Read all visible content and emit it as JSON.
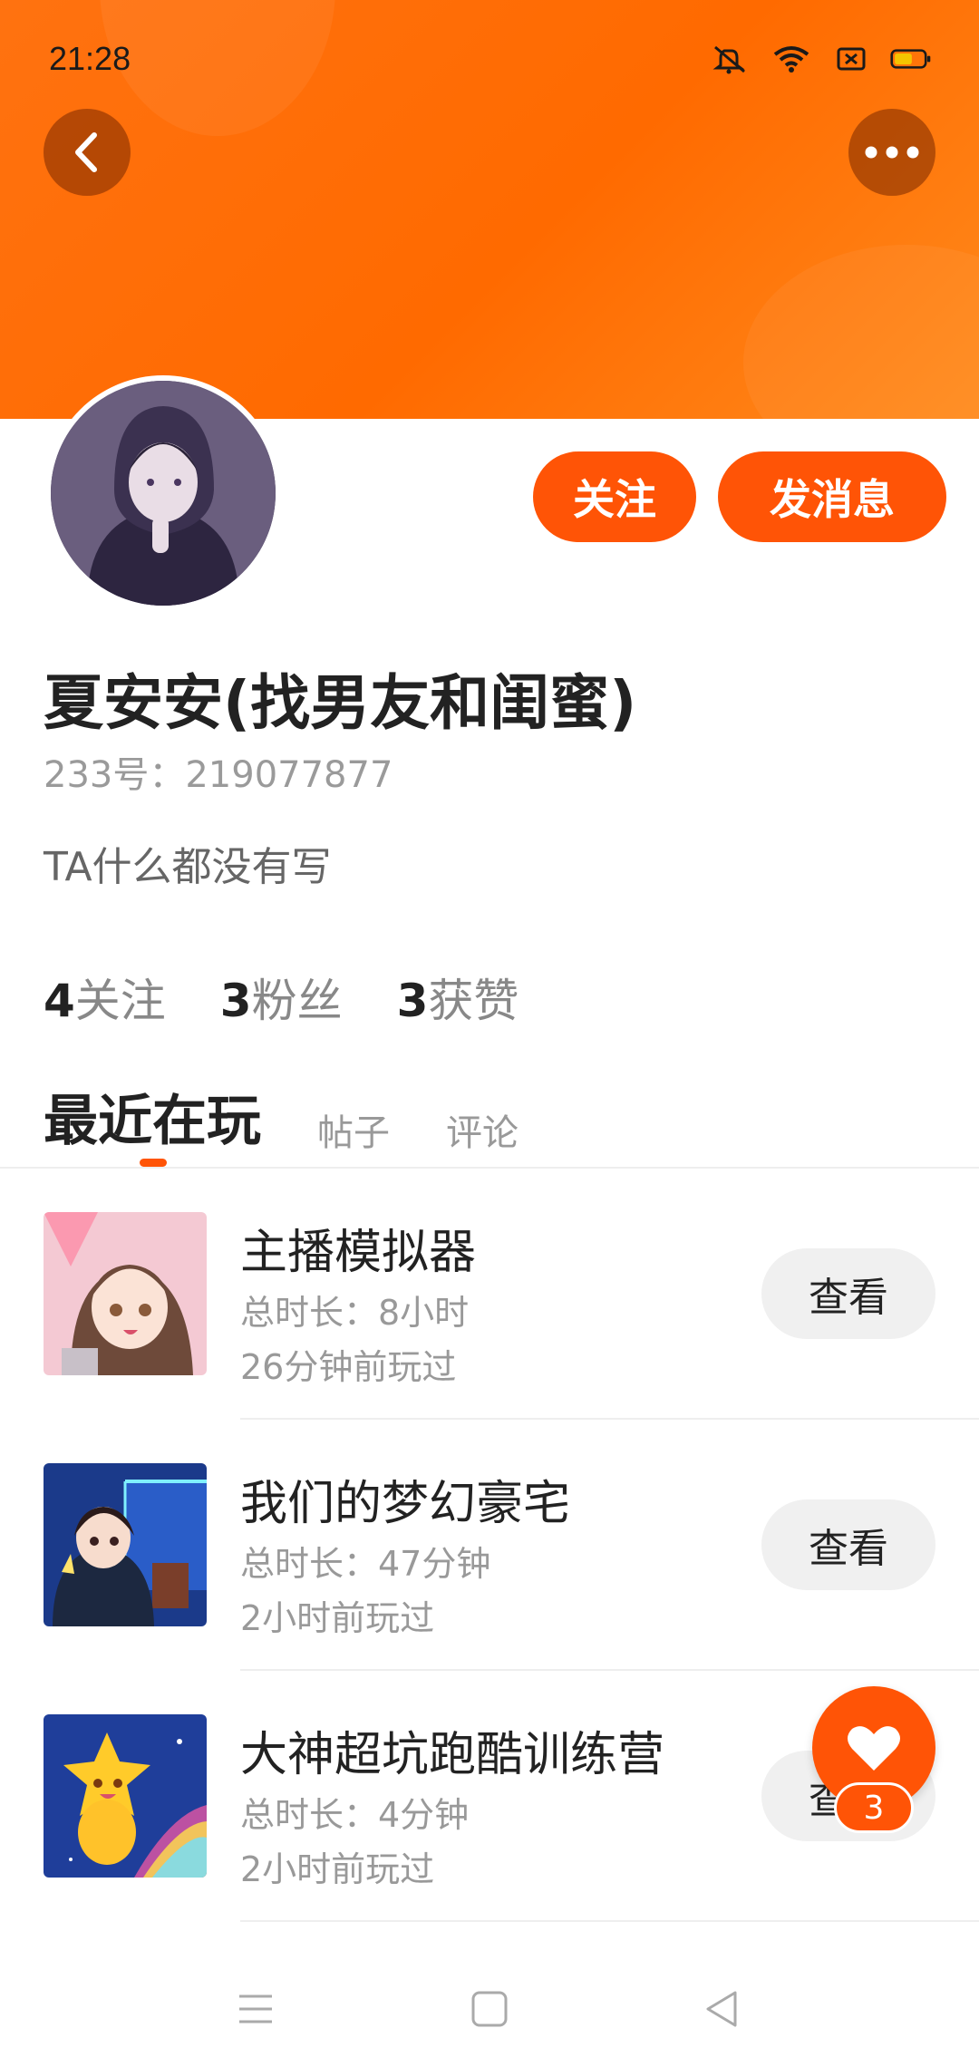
{
  "status_bar": {
    "time": "21:28"
  },
  "profile": {
    "name": "夏安安(找男友和闺蜜)",
    "uid": "233号：219077877",
    "bio": "TA什么都没有写",
    "follow_label": "关注",
    "message_label": "发消息",
    "stats": [
      {
        "num": "4",
        "label": "关注"
      },
      {
        "num": "3",
        "label": "粉丝"
      },
      {
        "num": "3",
        "label": "获赞"
      }
    ]
  },
  "tabs": [
    "最近在玩",
    "帖子",
    "评论"
  ],
  "games": [
    {
      "title": "主播模拟器",
      "duration": "总时长：8小时",
      "last_played": "26分钟前玩过",
      "button": "查看"
    },
    {
      "title": "我们的梦幻豪宅",
      "duration": "总时长：47分钟",
      "last_played": "2小时前玩过",
      "button": "查看"
    },
    {
      "title": "大神超坑跑酷训练营",
      "duration": "总时长：4分钟",
      "last_played": "2小时前玩过",
      "button": "查看"
    }
  ],
  "fab": {
    "badge": "3",
    "icon": "heart-icon"
  },
  "colors": {
    "accent": "#ff5406",
    "header": "#ff7210"
  }
}
